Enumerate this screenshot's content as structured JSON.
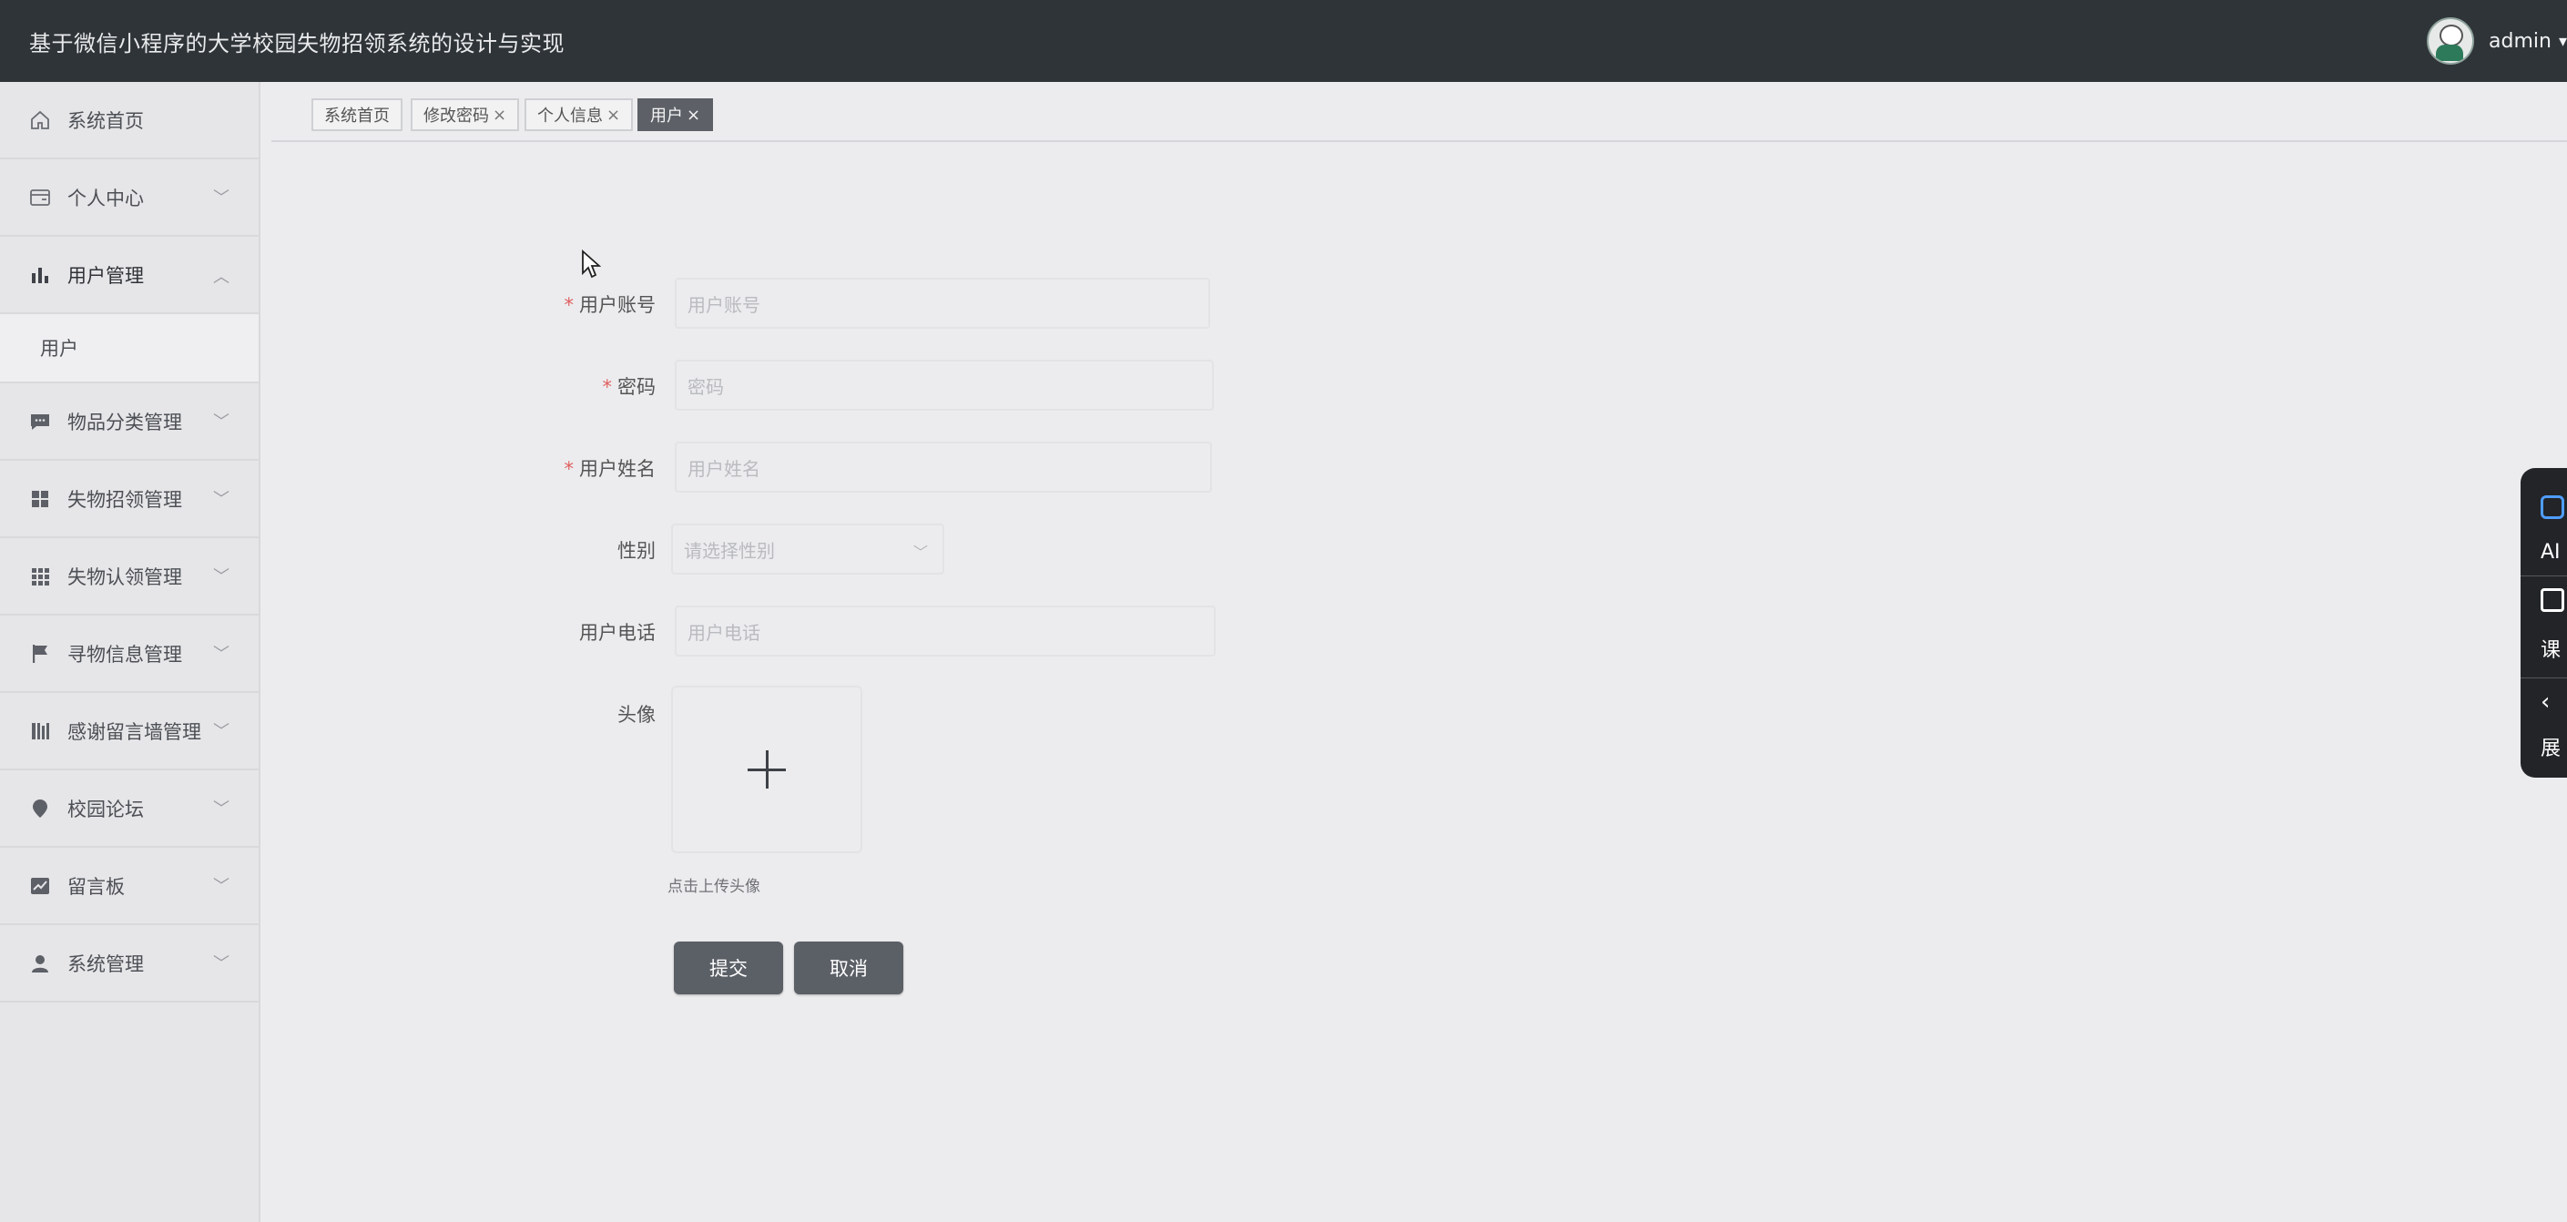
{
  "header": {
    "title": "基于微信小程序的大学校园失物招领系统的设计与实现",
    "user_name": "admin"
  },
  "sidebar": {
    "items": [
      {
        "label": "系统首页",
        "icon": "home-icon"
      },
      {
        "label": "个人中心",
        "icon": "card-icon"
      },
      {
        "label": "用户管理",
        "icon": "bar-chart-icon",
        "expanded": true
      },
      {
        "label": "物品分类管理",
        "icon": "message-icon"
      },
      {
        "label": "失物招领管理",
        "icon": "grid-icon"
      },
      {
        "label": "失物认领管理",
        "icon": "apps-icon"
      },
      {
        "label": "寻物信息管理",
        "icon": "flag-icon"
      },
      {
        "label": "感谢留言墙管理",
        "icon": "bars-icon"
      },
      {
        "label": "校园论坛",
        "icon": "location-icon"
      },
      {
        "label": "留言板",
        "icon": "trend-icon"
      },
      {
        "label": "系统管理",
        "icon": "user-icon"
      }
    ],
    "sub_items": [
      {
        "label": "用户"
      }
    ]
  },
  "tabs": [
    {
      "label": "系统首页",
      "closable": false
    },
    {
      "label": "修改密码",
      "closable": true
    },
    {
      "label": "个人信息",
      "closable": true
    },
    {
      "label": "用户",
      "closable": true,
      "active": true
    }
  ],
  "form": {
    "account": {
      "label": "用户账号",
      "placeholder": "用户账号",
      "required": true
    },
    "password": {
      "label": "密码",
      "placeholder": "密码",
      "required": true
    },
    "name": {
      "label": "用户姓名",
      "placeholder": "用户姓名",
      "required": true
    },
    "gender": {
      "label": "性别",
      "placeholder": "请选择性别",
      "required": false
    },
    "phone": {
      "label": "用户电话",
      "placeholder": "用户电话",
      "required": false
    },
    "avatar": {
      "label": "头像",
      "hint": "点击上传头像"
    },
    "submit_label": "提交",
    "cancel_label": "取消"
  },
  "float_panel": {
    "items": [
      {
        "label": "AI",
        "icon": "ai-icon"
      },
      {
        "label": "课",
        "icon": "book-icon"
      },
      {
        "label": "展",
        "icon": "expand-icon"
      }
    ]
  },
  "symbols": {
    "close": "×",
    "caret": "▾",
    "chevron_down": "﹀",
    "chevron_up": "︿"
  },
  "colors": {
    "header_bg": "#2f3438",
    "sidebar_bg": "#e6e6e8",
    "active_tab_bg": "#5d6167",
    "button_bg": "#5b5f66",
    "required_mark": "#e06060"
  }
}
